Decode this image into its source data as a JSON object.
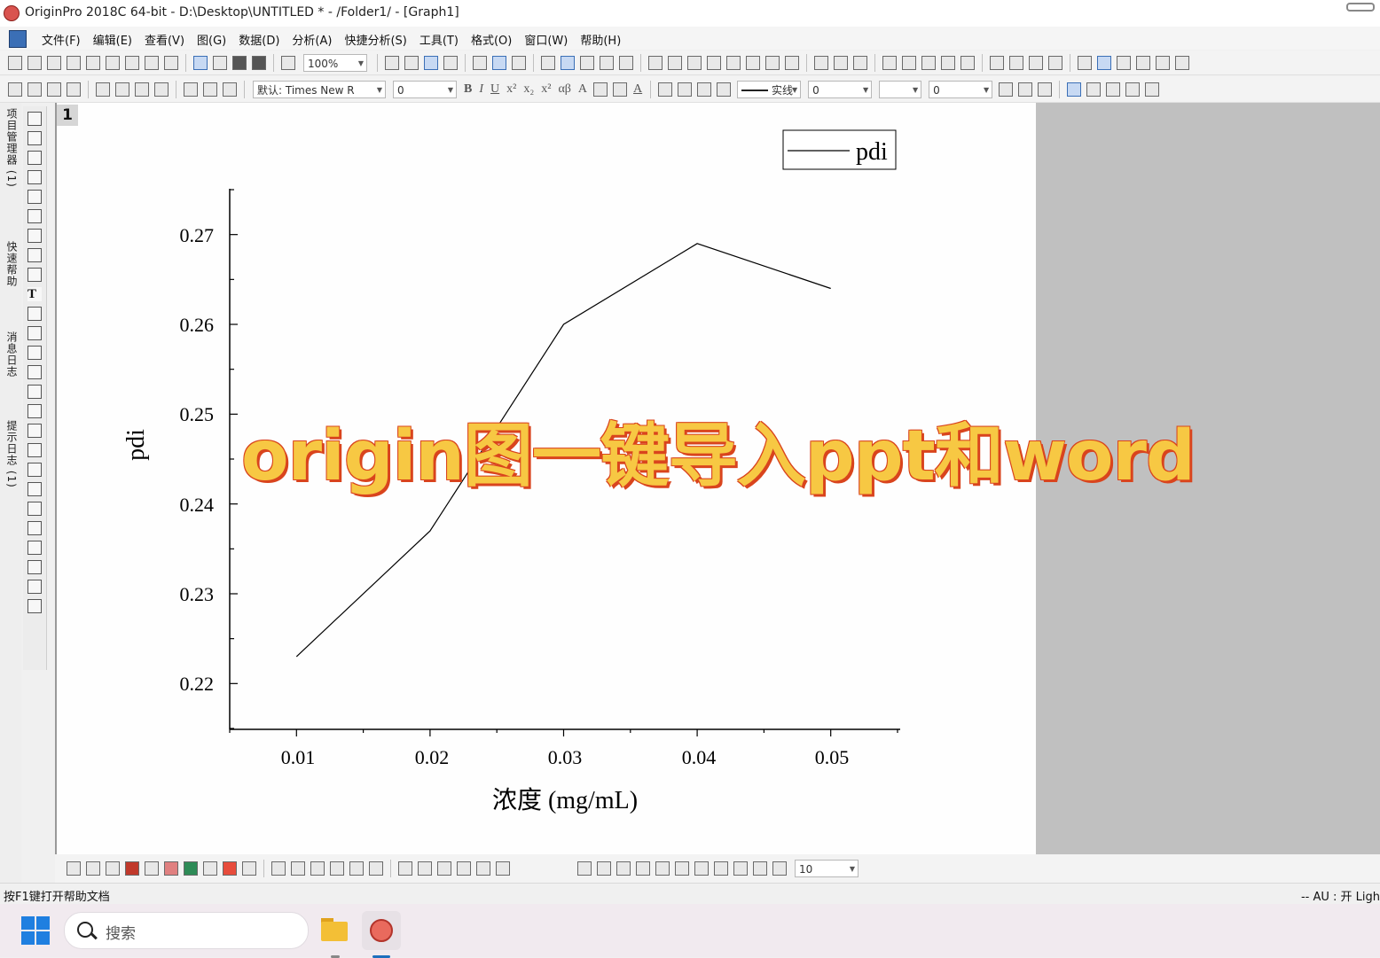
{
  "window": {
    "title": "OriginPro 2018C 64-bit - D:\\Desktop\\UNTITLED * - /Folder1/ - [Graph1]"
  },
  "menu": [
    "文件(F)",
    "编辑(E)",
    "查看(V)",
    "图(G)",
    "数据(D)",
    "分析(A)",
    "快捷分析(S)",
    "工具(T)",
    "格式(O)",
    "窗口(W)",
    "帮助(H)"
  ],
  "toolbar1": {
    "zoom": "100%"
  },
  "toolbar2": {
    "font": "默认: Times New R",
    "font_size": "0",
    "line_style": "实线",
    "line_width": "0",
    "fill_value": "0"
  },
  "left_tabs": [
    "项目管理器 (1)",
    "快速帮助",
    "消息日志",
    "提示日志 (1)"
  ],
  "graph": {
    "layer_number": "1"
  },
  "chart_data": {
    "type": "line",
    "x": [
      0.01,
      0.02,
      0.03,
      0.04,
      0.05
    ],
    "series": [
      {
        "name": "pdi",
        "values": [
          0.223,
          0.237,
          0.26,
          0.269,
          0.264
        ],
        "color": "#000000"
      }
    ],
    "xlabel": "浓度 (mg/mL)",
    "ylabel": "pdi",
    "xlim": [
      0.005,
      0.0552
    ],
    "ylim": [
      0.2149,
      0.2751
    ],
    "xticks": [
      "0.01",
      "0.02",
      "0.03",
      "0.04",
      "0.05"
    ],
    "yticks": [
      "0.22",
      "0.23",
      "0.24",
      "0.25",
      "0.26",
      "0.27"
    ],
    "legend": "top-right",
    "grid": false
  },
  "overlay": {
    "watermark": "origin图一键导入ppt和word"
  },
  "bottom_toolbar": {
    "size_value": "10"
  },
  "status": {
    "help": "按F1键打开帮助文档",
    "right": "--  AU : 开  Ligh"
  },
  "taskbar": {
    "search_placeholder": "搜索"
  },
  "colors": {
    "watermark_fill": "#f7c843",
    "watermark_outline": "#d9441d",
    "workspace": "#c0c0c0"
  }
}
